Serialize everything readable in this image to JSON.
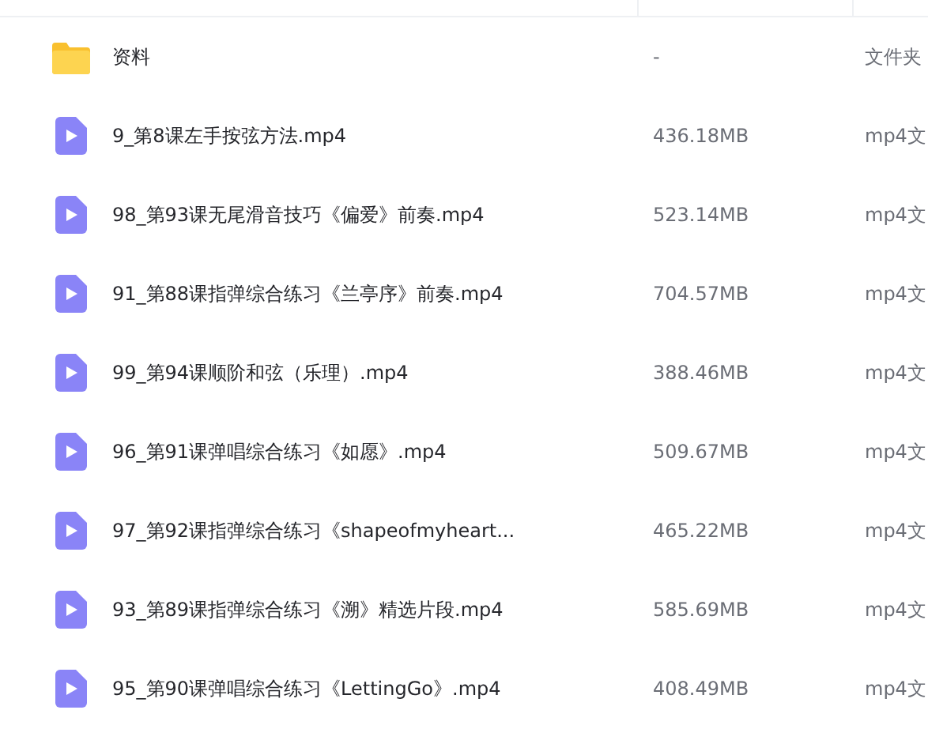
{
  "files": [
    {
      "kind": "folder",
      "name": "资料",
      "size": "-",
      "type": "文件夹"
    },
    {
      "kind": "video",
      "name": "9_第8课左手按弦方法.mp4",
      "size": "436.18MB",
      "type": "mp4文"
    },
    {
      "kind": "video",
      "name": "98_第93课无尾滑音技巧《偏爱》前奏.mp4",
      "size": "523.14MB",
      "type": "mp4文"
    },
    {
      "kind": "video",
      "name": "91_第88课指弹综合练习《兰亭序》前奏.mp4",
      "size": "704.57MB",
      "type": "mp4文"
    },
    {
      "kind": "video",
      "name": "99_第94课顺阶和弦（乐理）.mp4",
      "size": "388.46MB",
      "type": "mp4文"
    },
    {
      "kind": "video",
      "name": "96_第91课弹唱综合练习《如愿》.mp4",
      "size": "509.67MB",
      "type": "mp4文"
    },
    {
      "kind": "video",
      "name": "97_第92课指弹综合练习《shapeofmyheart...",
      "size": "465.22MB",
      "type": "mp4文"
    },
    {
      "kind": "video",
      "name": "93_第89课指弹综合练习《溯》精选片段.mp4",
      "size": "585.69MB",
      "type": "mp4文"
    },
    {
      "kind": "video",
      "name": "95_第90课弹唱综合练习《LettingGo》.mp4",
      "size": "408.49MB",
      "type": "mp4文"
    }
  ]
}
